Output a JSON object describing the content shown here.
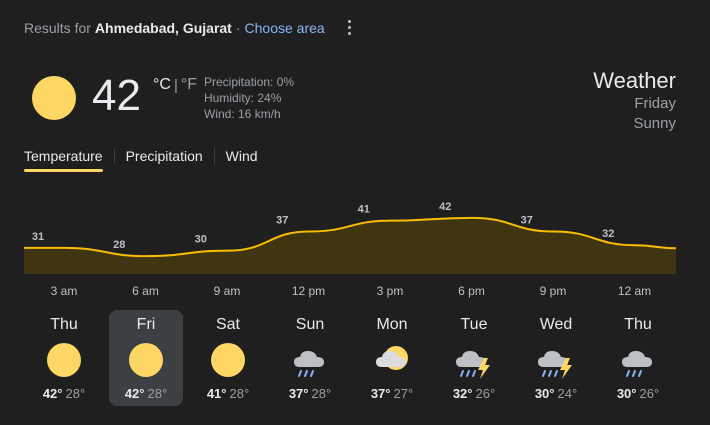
{
  "header": {
    "results_for": "Results for",
    "location": "Ahmedabad, Gujarat",
    "separator": "·",
    "choose_area": "Choose area"
  },
  "current": {
    "icon": "sun-icon",
    "temperature": "42",
    "unit_c": "°C",
    "unit_sep": "|",
    "unit_f": "°F",
    "precipitation": "Precipitation: 0%",
    "humidity": "Humidity: 24%",
    "wind": "Wind: 16 km/h",
    "title": "Weather",
    "day": "Friday",
    "condition": "Sunny"
  },
  "tabs": [
    {
      "label": "Temperature",
      "active": true
    },
    {
      "label": "Precipitation",
      "active": false
    },
    {
      "label": "Wind",
      "active": false
    }
  ],
  "colors": {
    "accent": "#fdd663",
    "chart_fill": "#3f3510",
    "chart_line": "#fbbc04",
    "link": "#8ab4f8",
    "background": "#1f1f1f"
  },
  "chart_data": {
    "type": "area",
    "x": [
      "3 am",
      "6 am",
      "9 am",
      "12 pm",
      "3 pm",
      "6 pm",
      "9 pm",
      "12 am"
    ],
    "values": [
      31,
      28,
      30,
      37,
      41,
      42,
      37,
      32
    ]
  },
  "time_labels": [
    "3 am",
    "6 am",
    "9 am",
    "12 pm",
    "3 pm",
    "6 pm",
    "9 pm",
    "12 am"
  ],
  "days": [
    {
      "name": "Thu",
      "icon": "sun-icon",
      "hi": "42°",
      "lo": "28°"
    },
    {
      "name": "Fri",
      "icon": "sun-icon",
      "hi": "42°",
      "lo": "28°"
    },
    {
      "name": "Sat",
      "icon": "sun-icon",
      "hi": "41°",
      "lo": "28°"
    },
    {
      "name": "Sun",
      "icon": "rain-cloud-icon",
      "hi": "37°",
      "lo": "28°"
    },
    {
      "name": "Mon",
      "icon": "partly-cloudy-icon",
      "hi": "37°",
      "lo": "27°"
    },
    {
      "name": "Tue",
      "icon": "thunderstorm-icon",
      "hi": "32°",
      "lo": "26°"
    },
    {
      "name": "Wed",
      "icon": "thunderstorm-icon",
      "hi": "30°",
      "lo": "24°"
    },
    {
      "name": "Thu",
      "icon": "rain-cloud-icon",
      "hi": "30°",
      "lo": "26°"
    }
  ]
}
